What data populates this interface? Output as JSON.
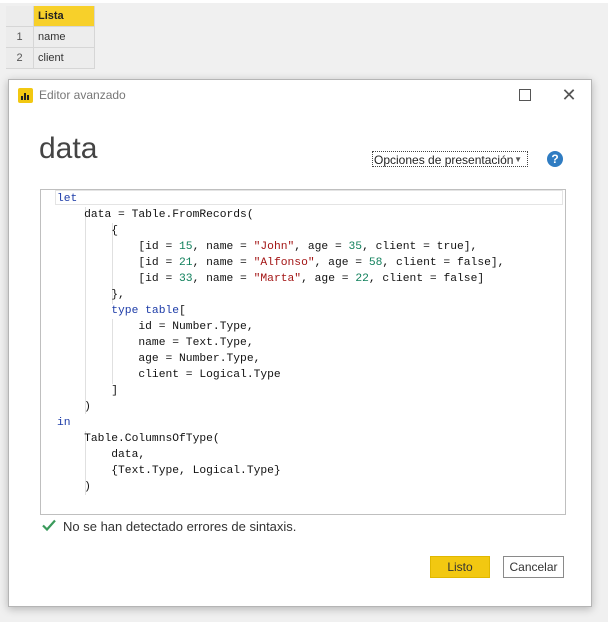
{
  "grid": {
    "column_header": "Lista",
    "rows": [
      {
        "num": "1",
        "value": "name"
      },
      {
        "num": "2",
        "value": "client"
      }
    ]
  },
  "dialog": {
    "title": "Editor avanzado",
    "query_name": "data",
    "view_options_label": "Opciones de presentación",
    "help_icon": "question-mark",
    "status_text": "No se han detectado errores de sintaxis.",
    "done_label": "Listo",
    "cancel_label": "Cancelar"
  },
  "code_lines": [
    "let",
    "    data = Table.FromRecords(",
    "        {",
    "            [id = 15, name = \"John\", age = 35, client = true],",
    "            [id = 21, name = \"Alfonso\", age = 58, client = false],",
    "            [id = 33, name = \"Marta\", age = 22, client = false]",
    "        },",
    "        type table[",
    "            id = Number.Type,",
    "            name = Text.Type,",
    "            age = Number.Type,",
    "            client = Logical.Type",
    "        ]",
    "    )",
    "in",
    "    Table.ColumnsOfType(",
    "        data,",
    "        {Text.Type, Logical.Type}",
    "    )"
  ],
  "colors": {
    "accent": "#f2c811",
    "keyword": "#1d3ca8",
    "number": "#0e7f5a",
    "string": "#a31515",
    "help": "#2f7cc2",
    "check": "#3a9a5b"
  }
}
